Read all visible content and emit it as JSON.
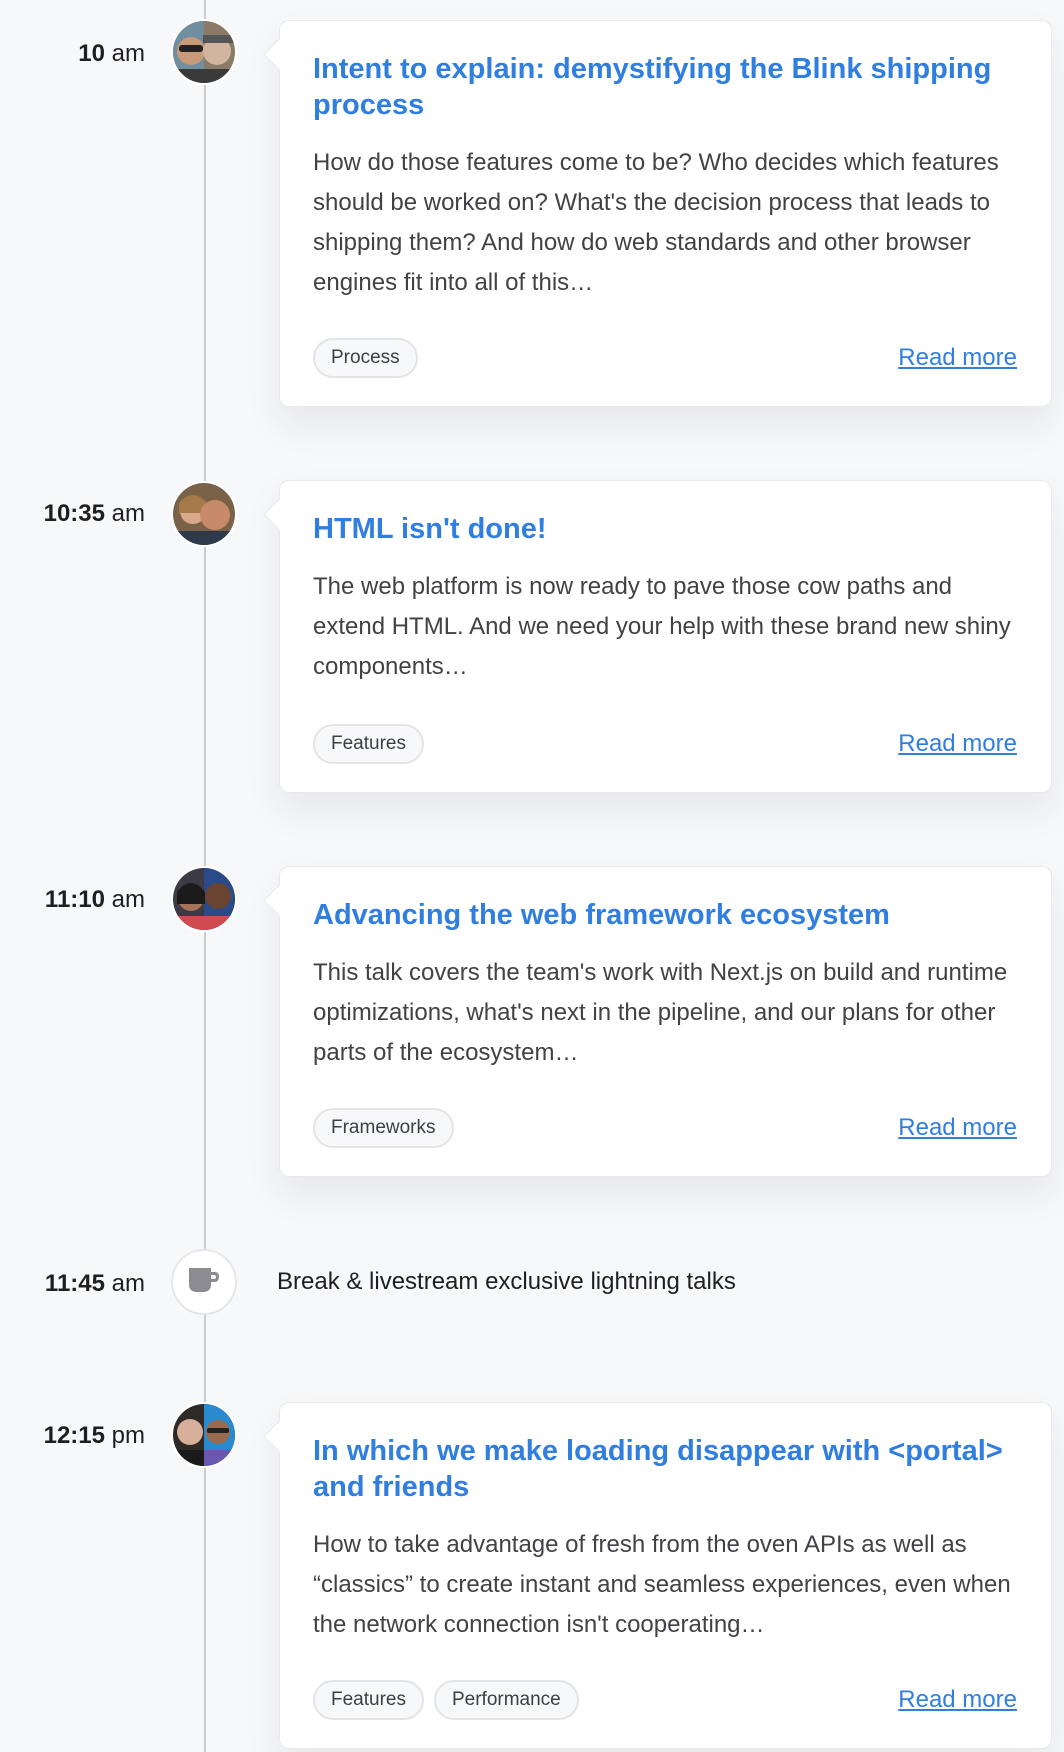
{
  "colors": {
    "accent": "#2f7ee0",
    "background": "#f7f8fa",
    "line": "#c9cbcf"
  },
  "sessions": [
    {
      "time_num": "10",
      "time_suffix": " am",
      "title": "Intent to explain: demystifying the Blink shipping process",
      "description": "How do those features come to be? Who decides which features should be worked on? What's the decision process that leads to shipping them? And how do web standards and other browser engines fit into all of this…",
      "tags": [
        "Process"
      ],
      "read_more": "Read more"
    },
    {
      "time_num": "10:35",
      "time_suffix": " am",
      "title": "HTML isn't done!",
      "description": "The web platform is now ready to pave those cow paths and extend HTML. And we need your help with these brand new shiny components…",
      "tags": [
        "Features"
      ],
      "read_more": "Read more"
    },
    {
      "time_num": "11:10",
      "time_suffix": " am",
      "title": "Advancing the web framework ecosystem",
      "description": "This talk covers the team's work with Next.js on build and runtime optimizations, what's next in the pipeline, and our plans for other parts of the ecosystem…",
      "tags": [
        "Frameworks"
      ],
      "read_more": "Read more"
    },
    {
      "time_num": "12:15",
      "time_suffix": " pm",
      "title": "In which we make loading disappear with <portal> and friends",
      "description": "How to take advantage of fresh from the oven APIs as well as “classics” to create instant and seamless experiences, even when the network connection isn't cooperating…",
      "tags": [
        "Features",
        "Performance"
      ],
      "read_more": "Read more"
    }
  ],
  "break": {
    "time_num": "11:45",
    "time_suffix": " am",
    "label": "Break & livestream exclusive lightning talks",
    "icon": "coffee-cup-icon"
  }
}
